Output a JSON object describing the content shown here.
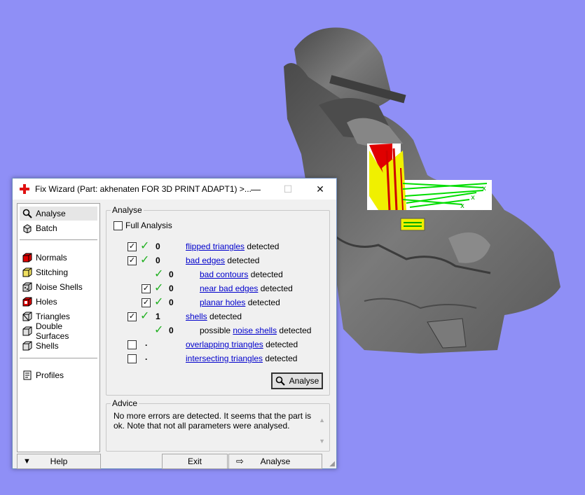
{
  "window": {
    "title": "Fix Wizard (Part: akhenaten FOR 3D PRINT ADAPT1) >...",
    "minimize": "—",
    "maximize": "☐",
    "close": "✕"
  },
  "nav": {
    "top": [
      {
        "label": "Analyse",
        "icon": "magnifier-icon",
        "selected": true
      },
      {
        "label": "Batch",
        "icon": "batch-icon"
      }
    ],
    "fixes": [
      {
        "label": "Normals",
        "icon": "normals-icon"
      },
      {
        "label": "Stitching",
        "icon": "stitching-icon"
      },
      {
        "label": "Noise Shells",
        "icon": "noise-shells-icon"
      },
      {
        "label": "Holes",
        "icon": "holes-icon"
      },
      {
        "label": "Triangles",
        "icon": "triangles-icon"
      },
      {
        "label": "Double Surfaces",
        "icon": "double-surfaces-icon"
      },
      {
        "label": "Shells",
        "icon": "shells-icon"
      }
    ],
    "bottom": [
      {
        "label": "Profiles",
        "icon": "profiles-icon"
      }
    ]
  },
  "analyse": {
    "legend": "Analyse",
    "full_analysis": "Full Analysis",
    "detected": "detected",
    "rows": {
      "flipped": {
        "count": "0",
        "link": "flipped triangles"
      },
      "bad_edges": {
        "count": "0",
        "link": "bad edges"
      },
      "bad_contours": {
        "count": "0",
        "link": "bad contours"
      },
      "near_bad_edges": {
        "count": "0",
        "link": "near bad edges"
      },
      "planar_holes": {
        "count": "0",
        "link": "planar holes"
      },
      "shells": {
        "count": "1",
        "link": "shells"
      },
      "noise_shells": {
        "count": "0",
        "prefix": "possible",
        "link": "noise shells"
      },
      "overlapping": {
        "count": ".",
        "link": "overlapping triangles"
      },
      "intersecting": {
        "count": ".",
        "link": "intersecting triangles"
      }
    },
    "analyse_button": "Analyse"
  },
  "advice": {
    "legend": "Advice",
    "text": "No more errors are detected. It seems that the part is ok. Note that not all parameters were analysed."
  },
  "footer": {
    "help": "Help",
    "exit": "Exit",
    "analyse": "Analyse"
  },
  "colors": {
    "background": "#8f8ff6",
    "model": "#6b6b6b",
    "check": "#22b022",
    "link": "#0000cc",
    "error_red": "#e00000",
    "warning_yellow": "#f0f000",
    "ok_green": "#00dd00"
  }
}
